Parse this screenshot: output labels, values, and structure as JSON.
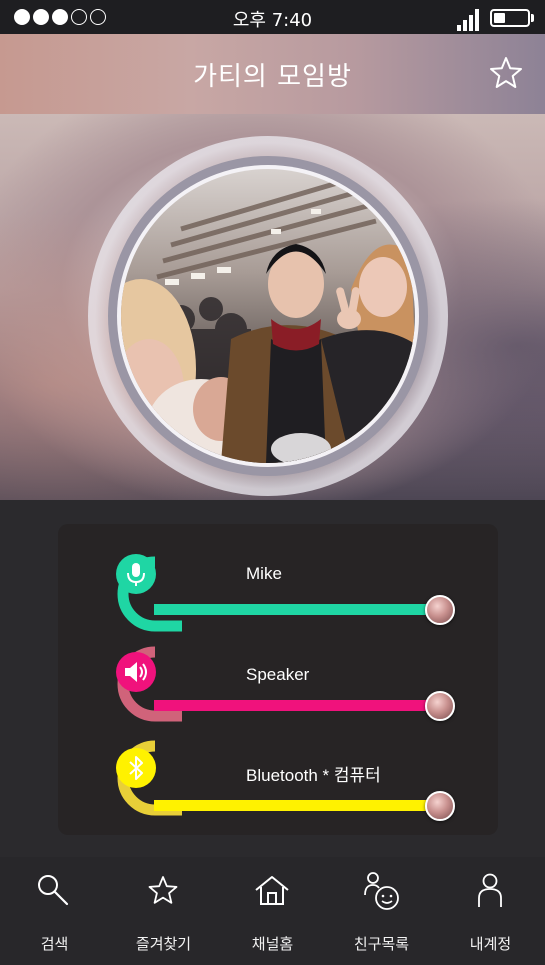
{
  "status_bar": {
    "signal_dots": [
      true,
      true,
      true,
      false,
      false
    ],
    "time": "오후 7:40",
    "battery_level": 0.33
  },
  "header": {
    "title": "가티의 모임방",
    "favorite_icon": "star-outline-icon"
  },
  "hero": {
    "photo_alt": "group-selfie-photo"
  },
  "controls": [
    {
      "id": "mike",
      "label": "Mike",
      "icon": "microphone-icon",
      "color": "#1fd6a4",
      "level": 1.0
    },
    {
      "id": "speaker",
      "label": "Speaker",
      "icon": "speaker-icon",
      "color": "#f0127c",
      "level": 1.0
    },
    {
      "id": "bluetooth",
      "label": "Bluetooth * 컴퓨터",
      "icon": "bluetooth-icon",
      "color": "#fff200",
      "level": 1.0
    }
  ],
  "gauge_colors": [
    "#1fd6a4",
    "#d0637a",
    "#e8cf38"
  ],
  "nav": [
    {
      "label": "검색",
      "icon": "search-icon"
    },
    {
      "label": "즐겨찾기",
      "icon": "star-icon"
    },
    {
      "label": "채널홈",
      "icon": "home-icon"
    },
    {
      "label": "친구목록",
      "icon": "friends-icon"
    },
    {
      "label": "내계정",
      "icon": "person-icon"
    }
  ]
}
